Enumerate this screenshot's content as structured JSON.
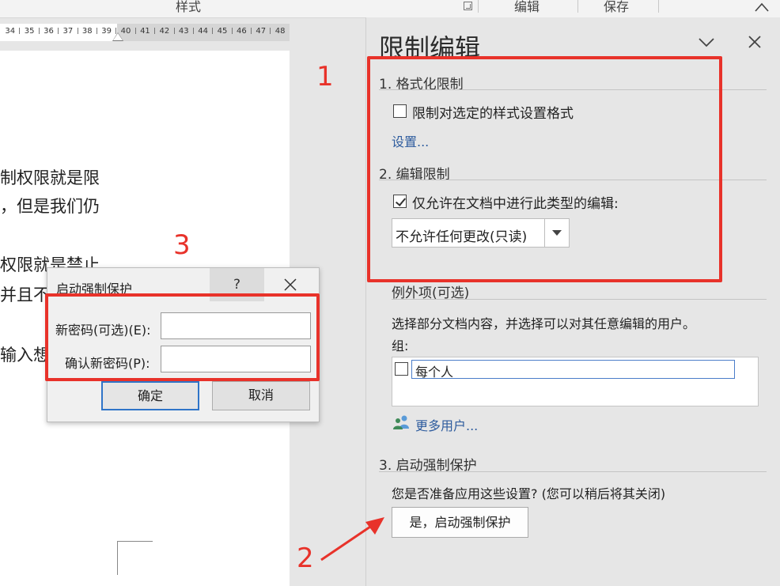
{
  "ribbon": {
    "styles_group": "样式",
    "editing_group": "编辑",
    "save_group": "保存"
  },
  "ruler": {
    "ticks": [
      "34",
      "35",
      "36",
      "37",
      "38",
      "39",
      "40",
      "41",
      "42",
      "43",
      "44",
      "45",
      "46",
      "47",
      "48"
    ]
  },
  "document": {
    "lines": [
      "制权限就是限",
      "，但是我们仍",
      "权限就是禁止",
      "并且不",
      "输入想"
    ]
  },
  "annotations": {
    "n1": "1",
    "n2": "2",
    "n3": "3"
  },
  "panel": {
    "title": "限制编辑",
    "section1": {
      "heading": "1. 格式化限制",
      "checkbox_label": "限制对选定的样式设置格式",
      "checked": false,
      "settings_link": "设置..."
    },
    "section2": {
      "heading": "2. 编辑限制",
      "checkbox_label": "仅允许在文档中进行此类型的编辑:",
      "checked": true,
      "select_value": "不允许任何更改(只读)"
    },
    "exceptions": {
      "heading": "例外项(可选)",
      "description": "选择部分文档内容，并选择可以对其任意编辑的用户。",
      "groups_label": "组:",
      "group_item": "每个人",
      "more_users_link": "更多用户..."
    },
    "section3": {
      "heading": "3. 启动强制保护",
      "question": "您是否准备应用这些设置? (您可以稍后将其关闭)",
      "start_button": "是，启动强制保护"
    }
  },
  "dialog": {
    "title": "启动强制保护",
    "help": "?",
    "new_password_label": "新密码(可选)(E):",
    "confirm_password_label": "确认新密码(P):",
    "new_password_value": "",
    "confirm_password_value": "",
    "ok_button": "确定",
    "cancel_button": "取消"
  },
  "colors": {
    "annotation_red": "#e8322a",
    "link_blue": "#2e5c9e",
    "default_button_border": "#2f74c8"
  }
}
